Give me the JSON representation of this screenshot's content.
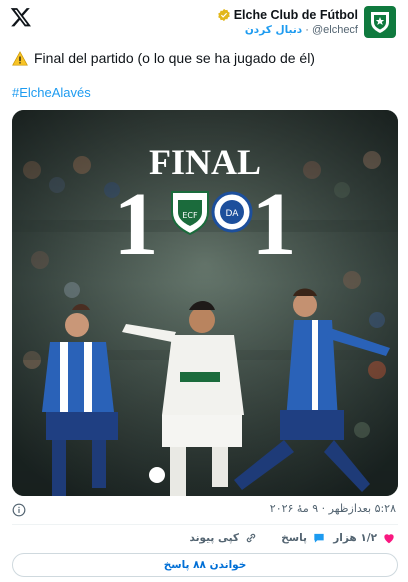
{
  "header": {
    "display_name": "Elche Club de Fútbol",
    "handle": "@elchecf",
    "follow_label": "دنبال کردن",
    "separator": "·"
  },
  "tweet": {
    "text": "Final del partido (o lo que se ha jugado de él)",
    "hashtag": "#ElcheAlavés"
  },
  "media": {
    "final_label": "FINAL",
    "home_score": "1",
    "away_score": "1"
  },
  "meta": {
    "timestamp": "۵:۲۸ بعدازظهر · ۹ مهٔ ۲۰۲۶"
  },
  "actions": {
    "likes": "۱/۲ هزار",
    "reply_label": "پاسخ",
    "copy_link_label": "کپی پیوند",
    "read_replies_label": "خواندن ۸۸ پاسخ"
  },
  "colors": {
    "brand_blue": "#1d9bf0",
    "like_red": "#f91880",
    "elche_green": "#0f7a3e"
  }
}
